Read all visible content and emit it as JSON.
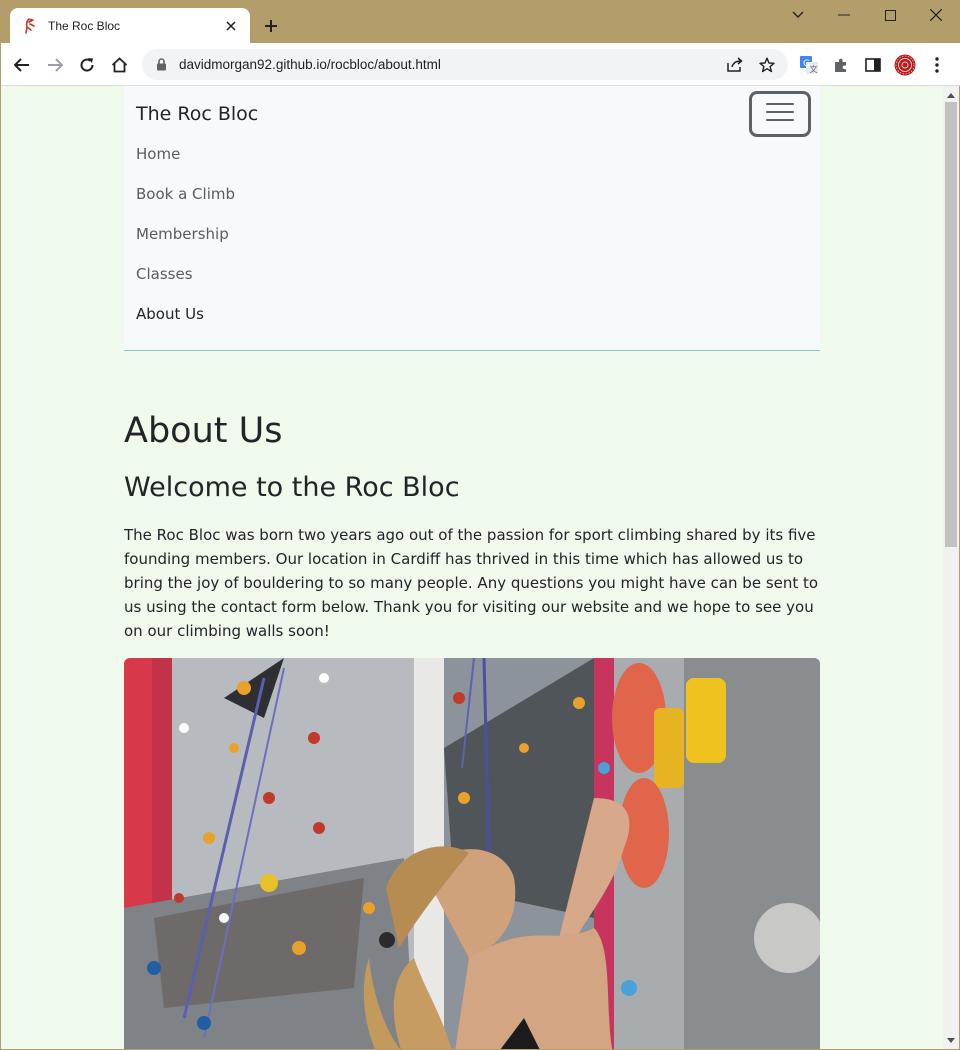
{
  "browser": {
    "tab_title": "The Roc Bloc",
    "url": "davidmorgan92.github.io/rocbloc/about.html"
  },
  "navbar": {
    "brand": "The Roc Bloc",
    "links": [
      "Home",
      "Book a Climb",
      "Membership",
      "Classes",
      "About Us"
    ],
    "active_link": "About Us"
  },
  "page": {
    "heading": "About Us",
    "subheading": "Welcome to the Roc Bloc",
    "paragraph": "The Roc Bloc was born two years ago out of the passion for sport climbing shared by its five founding members. Our location in Cardiff has thrived in this time which has allowed us to bring the joy of bouldering to so many people. Any questions you might have can be sent to us using the contact form below. Thank you for visiting our website and we hope to see you on our climbing walls soon!"
  },
  "colors": {
    "chrome": "#b39d6b",
    "page_background": "#eff9ec",
    "navbar_background": "#f8f9fa",
    "navbar_border": "#8fc6bd",
    "text": "#212529"
  },
  "icons": {
    "favicon": "climber-icon",
    "back": "arrow-left-icon",
    "forward": "arrow-right-icon",
    "reload": "reload-icon",
    "home": "home-icon",
    "lock": "lock-icon",
    "share": "share-icon",
    "bookmark": "star-icon",
    "translate": "translate-icon",
    "extensions": "puzzle-icon",
    "side_panel": "side-panel-icon",
    "profile": "avatar-icon",
    "menu": "kebab-menu-icon",
    "toggler": "hamburger-icon"
  }
}
